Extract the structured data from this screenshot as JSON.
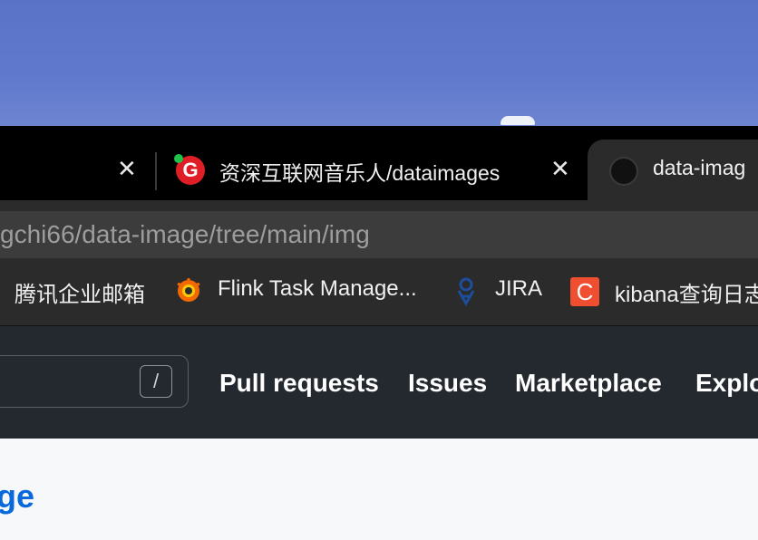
{
  "tabs": [
    {
      "title": "",
      "close": "✕"
    },
    {
      "title": "资深互联网音乐人/dataimages",
      "close": "✕",
      "favicon": "G"
    },
    {
      "title": "data-imag",
      "favicon": "github-icon"
    }
  ],
  "address_bar": {
    "url": "gchi66/data-image/tree/main/img"
  },
  "bookmarks": [
    {
      "label": "腾讯企业邮箱"
    },
    {
      "label": "Flink Task Manage..."
    },
    {
      "label": "JIRA"
    },
    {
      "label": "kibana查询日志"
    }
  ],
  "github": {
    "search_shortcut": "/",
    "nav": [
      "Pull requests",
      "Issues",
      "Marketplace",
      "Explore"
    ],
    "repo_name_partial": "ge"
  },
  "colors": {
    "accent": "#0969da",
    "header_bg": "#24292f"
  }
}
